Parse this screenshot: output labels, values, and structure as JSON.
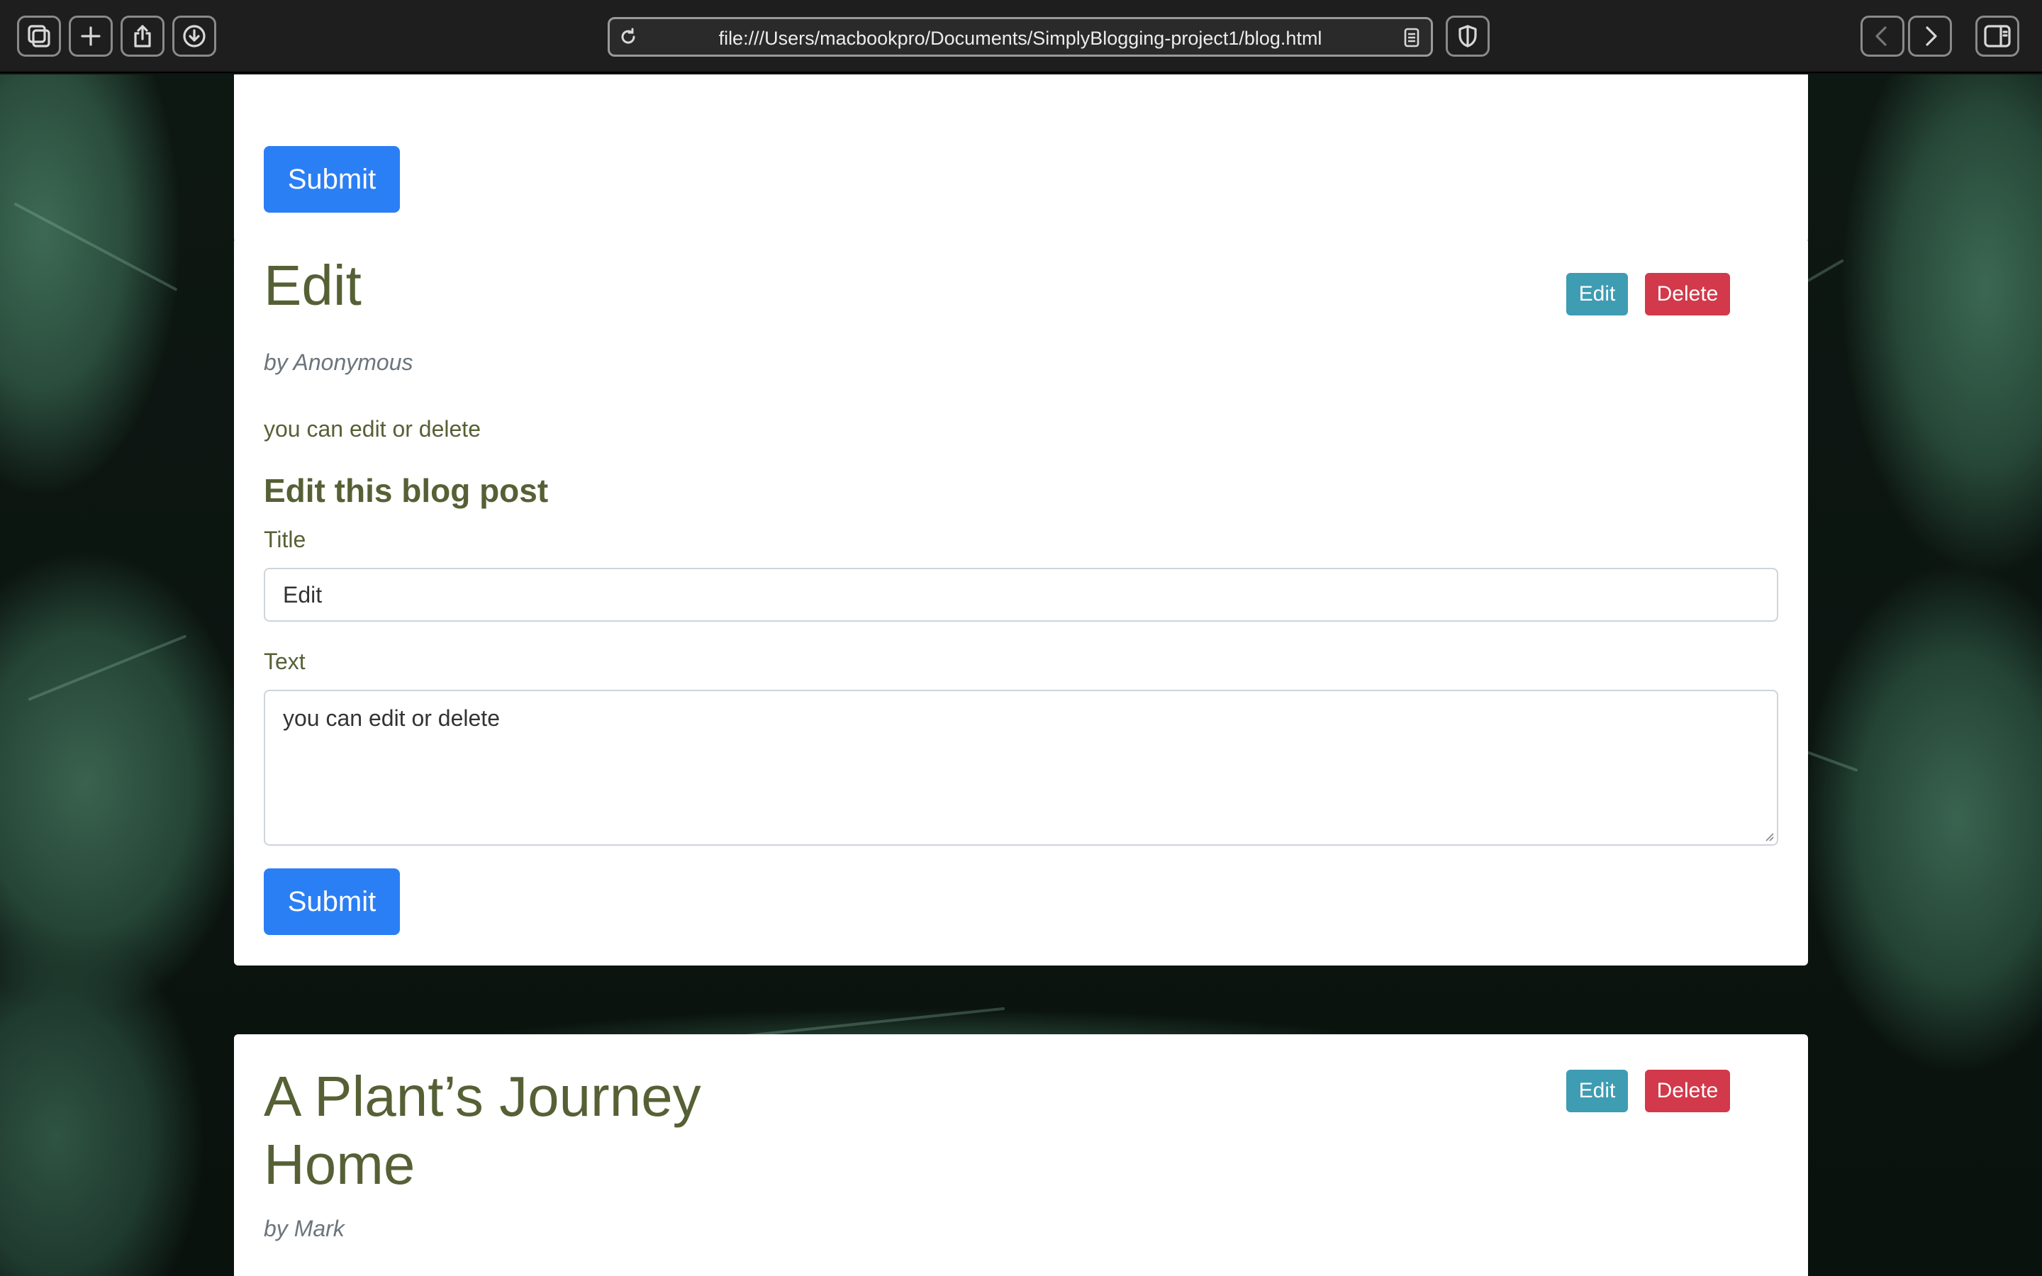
{
  "browser": {
    "url": "file:///Users/macbookpro/Documents/SimplyBlogging-project1/blog.html",
    "icons": [
      "tabs-overview-icon",
      "new-tab-icon",
      "share-icon",
      "downloads-icon",
      "reload-icon",
      "reader-icon",
      "privacy-shield-icon",
      "back-icon",
      "forward-icon",
      "sidebar-icon"
    ]
  },
  "top_card": {
    "submit_label": "Submit"
  },
  "posts": [
    {
      "title": "Edit",
      "byline": "by Anonymous",
      "text": "you can edit or delete",
      "edit_label": "Edit",
      "delete_label": "Delete",
      "form": {
        "heading": "Edit this blog post",
        "title_label": "Title",
        "title_value": "Edit",
        "text_label": "Text",
        "text_value": "you can edit or delete",
        "submit_label": "Submit"
      }
    },
    {
      "title_line1": "A Plant’s Journey",
      "title_line2": "Home",
      "byline": "by Mark",
      "edit_label": "Edit",
      "delete_label": "Delete"
    }
  ],
  "colors": {
    "primary": "#2b7ff5",
    "info": "#3e9cb3",
    "danger": "#d2394a",
    "heading": "#566035",
    "muted": "#6c757d"
  }
}
